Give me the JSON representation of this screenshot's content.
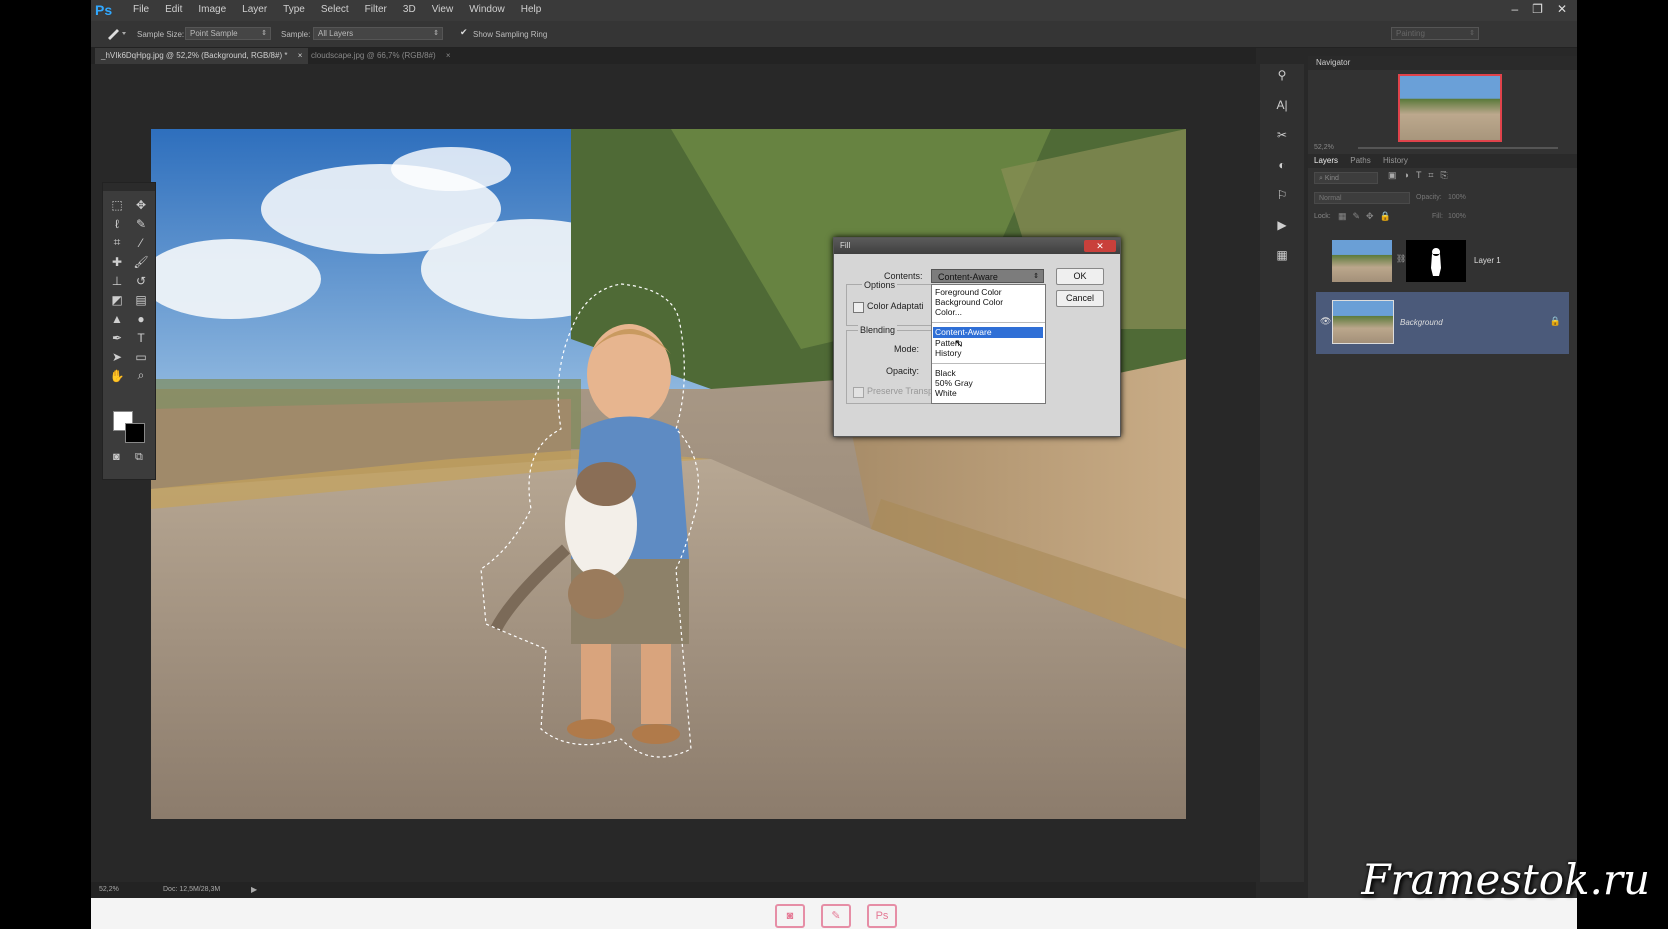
{
  "app": {
    "logo": "Ps",
    "menu": [
      "File",
      "Edit",
      "Image",
      "Layer",
      "Type",
      "Select",
      "Filter",
      "3D",
      "View",
      "Window",
      "Help"
    ],
    "window_controls": [
      "–",
      "❐",
      "✕"
    ]
  },
  "options_bar": {
    "sample_size_label": "Sample Size:",
    "sample_size_value": "Point Sample",
    "sample_label": "Sample:",
    "sample_value": "All Layers",
    "show_sampling_ring": "Show Sampling Ring",
    "workspace": "Painting"
  },
  "tabs": [
    {
      "label": "_hVIk6DqHpg.jpg @ 52,2% (Background, RGB/8#) *",
      "active": true
    },
    {
      "label": "cloudscape.jpg @ 66,7% (RGB/8#)",
      "active": false
    }
  ],
  "status": {
    "zoom": "52,2%",
    "doc": "Doc: 12,5M/28,3M"
  },
  "fill_dialog": {
    "title": "Fill",
    "contents_label": "Contents:",
    "contents_value": "Content-Aware",
    "options_label": "Options",
    "color_adaptation": "Color Adaptati",
    "blending_label": "Blending",
    "mode_label": "Mode:",
    "opacity_label": "Opacity:",
    "preserve_transparency": "Preserve Transparency",
    "ok": "OK",
    "cancel": "Cancel",
    "close": "✕",
    "dropdown_group1": [
      "Foreground Color",
      "Background Color",
      "Color..."
    ],
    "dropdown_group2": [
      "Content-Aware",
      "Pattern",
      "History"
    ],
    "dropdown_group3": [
      "Black",
      "50% Gray",
      "White"
    ]
  },
  "navigator": {
    "title": "Navigator",
    "zoom": "52,2%"
  },
  "layers_panel": {
    "tabs": [
      "Layers",
      "Paths",
      "History"
    ],
    "filter": "Kind",
    "blend": "Normal",
    "opacity_label": "Opacity:",
    "opacity_value": "100%",
    "lock_label": "Lock:",
    "fill_label": "Fill:",
    "fill_value": "100%",
    "layers": [
      {
        "name": "Layer 1",
        "italic": false
      },
      {
        "name": "Background",
        "italic": true
      }
    ]
  },
  "footer": {
    "watermark": "Framestok.ru",
    "icons": [
      "camera-icon",
      "edit-icon",
      "ps-icon"
    ]
  },
  "colors": {
    "accent_select": "#2f6fd6",
    "layer_selected": "#4b5a7a",
    "ps_blue": "#31a8ff"
  }
}
